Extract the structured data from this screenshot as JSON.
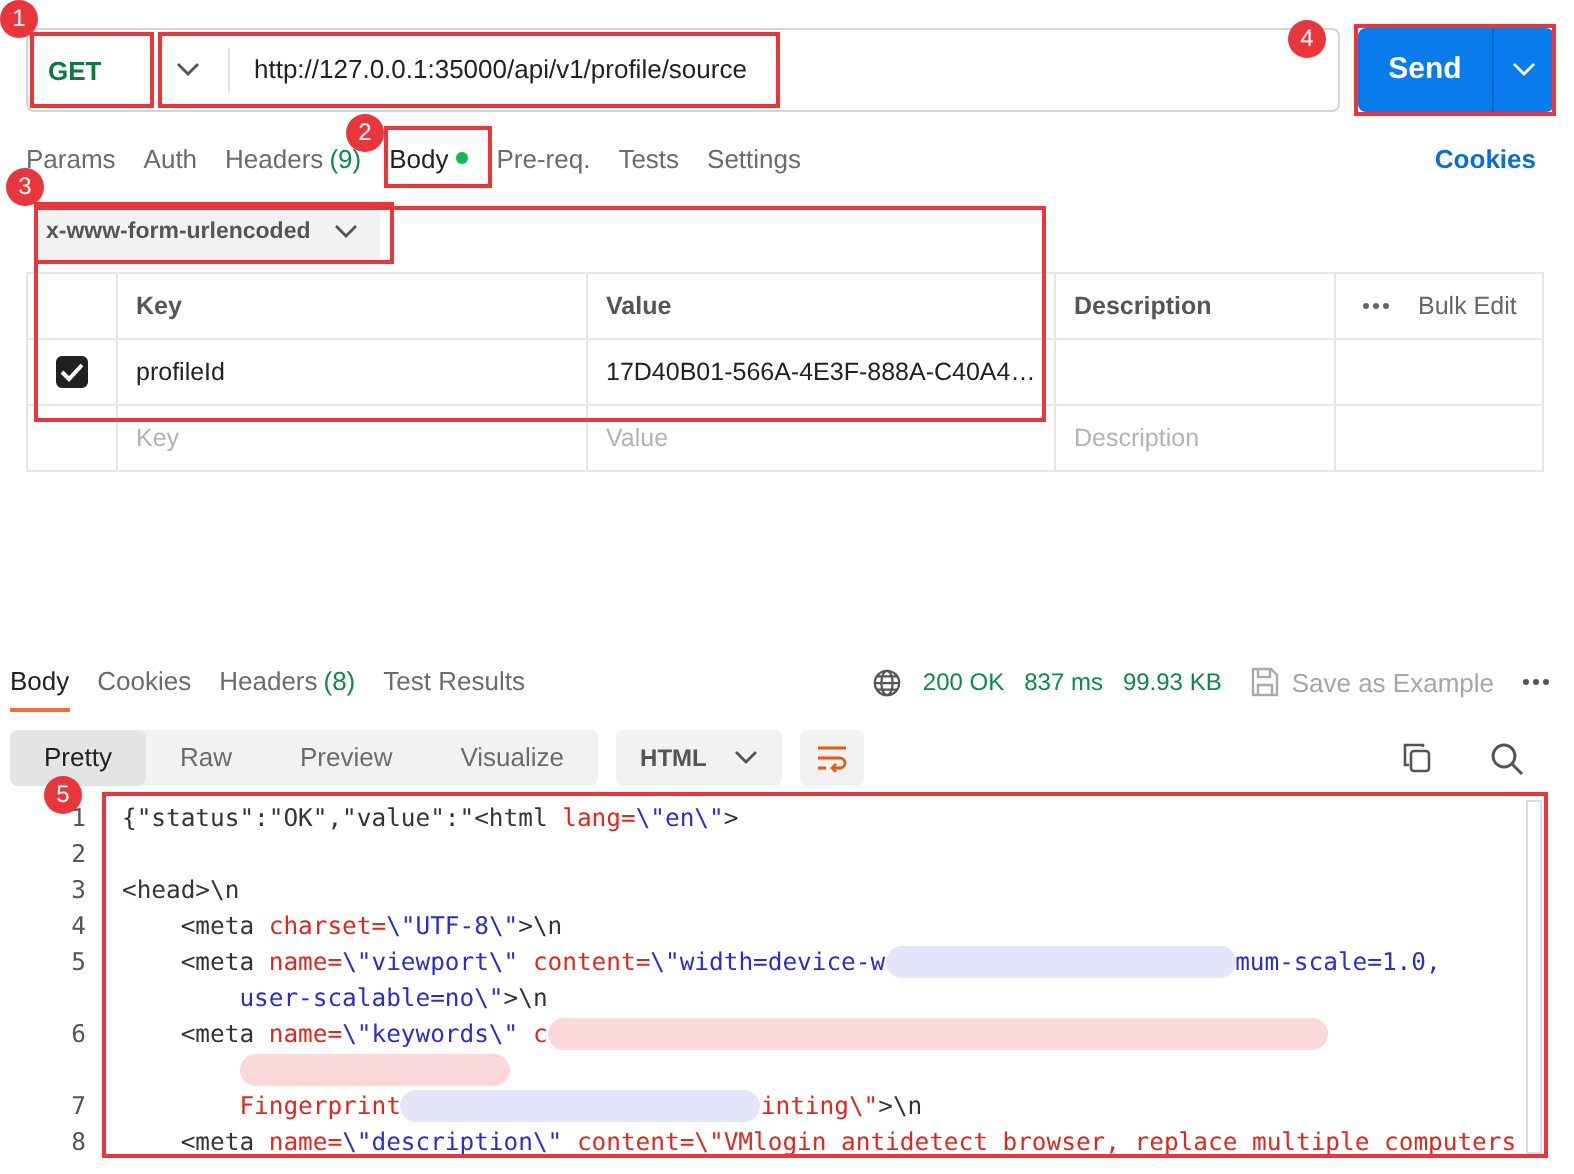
{
  "request": {
    "method": "GET",
    "url": "http://127.0.0.1:35000/api/v1/profile/source",
    "send_label": "Send"
  },
  "request_tabs": [
    {
      "label": "Params",
      "selected": false
    },
    {
      "label": "Auth",
      "selected": false
    },
    {
      "label": "Headers",
      "count": "(9)",
      "selected": false
    },
    {
      "label": "Body",
      "selected": true,
      "dot": true
    },
    {
      "label": "Pre-req.",
      "selected": false
    },
    {
      "label": "Tests",
      "selected": false
    },
    {
      "label": "Settings",
      "selected": false
    }
  ],
  "cookies_link": "Cookies",
  "body_type": "x-www-form-urlencoded",
  "params_table": {
    "columns": [
      "Key",
      "Value",
      "Description"
    ],
    "bulk_edit": "Bulk Edit",
    "rows": [
      {
        "checked": true,
        "key": "profileId",
        "value": "17D40B01-566A-4E3F-888A-C40A4…"
      }
    ],
    "placeholder_row": {
      "key": "Key",
      "value": "Value",
      "description": "Description"
    }
  },
  "response": {
    "tabs": [
      {
        "label": "Body",
        "selected": true
      },
      {
        "label": "Cookies",
        "selected": false
      },
      {
        "label": "Headers",
        "count": "(8)",
        "selected": false
      },
      {
        "label": "Test Results",
        "selected": false
      }
    ],
    "status": "200 OK",
    "time": "837 ms",
    "size": "99.93 KB",
    "save": "Save as Example",
    "views": [
      {
        "label": "Pretty",
        "selected": true
      },
      {
        "label": "Raw",
        "selected": false
      },
      {
        "label": "Preview",
        "selected": false
      },
      {
        "label": "Visualize",
        "selected": false
      }
    ],
    "format": "HTML",
    "code": [
      {
        "number": "1",
        "segments": [
          {
            "kind": "plain",
            "text": "{\"status\":\"OK\",\"value\":\"<html "
          },
          {
            "kind": "attr",
            "text": "lang="
          },
          {
            "kind": "string",
            "text": "\\\"en\\\""
          },
          {
            "kind": "plain",
            "text": ">"
          }
        ]
      },
      {
        "number": "2"
      },
      {
        "number": "3",
        "segments": [
          {
            "kind": "plain",
            "text": "<head>\\n"
          }
        ]
      },
      {
        "number": "4",
        "segments": [
          {
            "kind": "plain",
            "text": "    <meta "
          },
          {
            "kind": "attr",
            "text": "charset="
          },
          {
            "kind": "string",
            "text": "\\\"UTF-8\\\""
          },
          {
            "kind": "plain",
            "text": ">\\n"
          }
        ]
      },
      {
        "number": "5",
        "segments": [
          {
            "kind": "plain",
            "text": "    <meta "
          },
          {
            "kind": "attr",
            "text": "name="
          },
          {
            "kind": "string",
            "text": "\\\"viewport\\\""
          },
          {
            "kind": "attr",
            "text": " content="
          },
          {
            "kind": "string",
            "text": "\\\"width=device-w"
          },
          {
            "kind": "blur",
            "color": "#e4e4fa"
          },
          {
            "kind": "string",
            "text": "mum-scale=1.0,"
          }
        ]
      },
      {
        "segments": [
          {
            "kind": "string",
            "text": "        user-scalable=no\\\""
          },
          {
            "kind": "plain",
            "text": ">\\n"
          }
        ]
      },
      {
        "number": "6",
        "segments": [
          {
            "kind": "plain",
            "text": "    <meta "
          },
          {
            "kind": "attr",
            "text": "name="
          },
          {
            "kind": "string",
            "text": "\\\"keywords\\\""
          },
          {
            "kind": "attr",
            "text": " c"
          },
          {
            "kind": "blur",
            "color": "#fbd9d9"
          }
        ]
      },
      {
        "segments": [
          {
            "kind": "blur",
            "color": "#fbd9d9"
          }
        ]
      },
      {
        "number": "7",
        "segments": [
          {
            "kind": "attr",
            "text": "        Fingerprint"
          },
          {
            "kind": "blur",
            "color": "#e4e4fa"
          },
          {
            "kind": "attr",
            "text": "inting\\\""
          },
          {
            "kind": "plain",
            "text": ">\\n"
          }
        ]
      },
      {
        "number": "8",
        "segments": [
          {
            "kind": "plain",
            "text": "    <meta "
          },
          {
            "kind": "attr",
            "text": "name="
          },
          {
            "kind": "string",
            "text": "\\\"description\\\""
          },
          {
            "kind": "attr",
            "text": " content="
          },
          {
            "kind": "attr",
            "text": "\\\"VMlogin antidetect browser, replace multiple computers"
          }
        ]
      }
    ]
  },
  "annotations": [
    {
      "number": "1"
    },
    {
      "number": "2"
    },
    {
      "number": "3"
    },
    {
      "number": "4"
    },
    {
      "number": "5"
    }
  ]
}
